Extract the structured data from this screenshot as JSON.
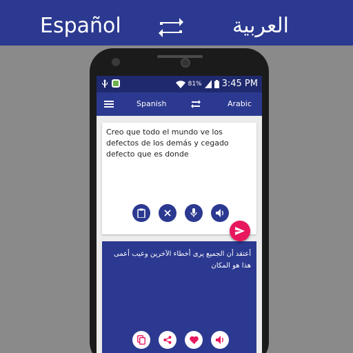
{
  "banner": {
    "source_lang": "Español",
    "target_lang": "العربية",
    "swap_icon": "swap-arrows-icon"
  },
  "statusbar": {
    "battery_percent": "81%",
    "time": "3:45 PM",
    "icons": [
      "usb-icon",
      "app-notification-icon",
      "wifi-icon",
      "signal-icon",
      "battery-icon"
    ]
  },
  "appbar": {
    "menu_icon": "hamburger-menu-icon",
    "source_lang": "Spanish",
    "swap_icon": "swap-arrows-icon",
    "target_lang": "Arabic"
  },
  "input": {
    "text": "Creo que todo el mundo ve los defectos de los demás y cegado defecto que es donde",
    "buttons": [
      "paste-icon",
      "clear-icon",
      "microphone-icon",
      "speaker-icon"
    ]
  },
  "translate_button": {
    "icon": "send-icon"
  },
  "output": {
    "text": "أعتقد أن الجميع يرى أخطاء الآخرين وعيب أعمى هذا هو المكان",
    "buttons": [
      "copy-icon",
      "share-icon",
      "favorite-icon",
      "speaker-icon"
    ]
  },
  "colors": {
    "primary": "#2b3990",
    "status_bar": "#1f2a6e",
    "accent": "#e8175d",
    "background": "#8a8a8a",
    "favorite": "#e8175d"
  }
}
